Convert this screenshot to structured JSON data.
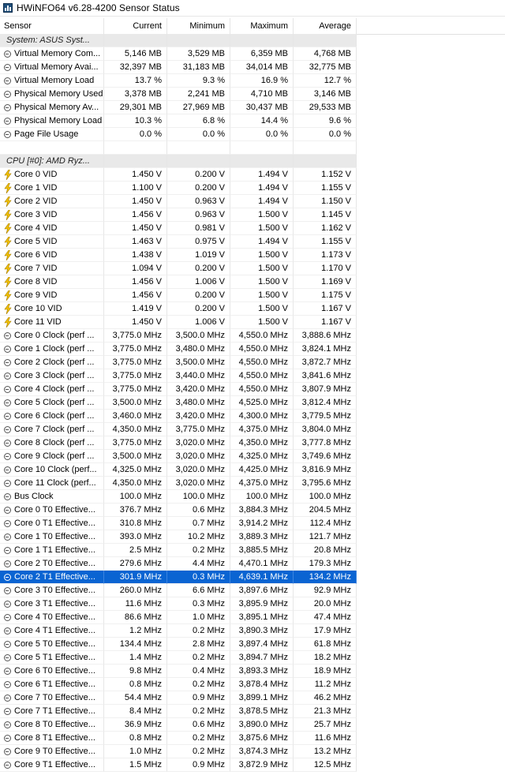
{
  "window": {
    "title": "HWiNFO64 v6.28-4200 Sensor Status"
  },
  "columns": [
    "Sensor",
    "Current",
    "Minimum",
    "Maximum",
    "Average"
  ],
  "rows": [
    {
      "type": "group",
      "label": "System: ASUS Syst..."
    },
    {
      "type": "sensor",
      "icon": "clock",
      "label": "Virtual Memory Com...",
      "cur": "5,146 MB",
      "min": "3,529 MB",
      "max": "6,359 MB",
      "avg": "4,768 MB"
    },
    {
      "type": "sensor",
      "icon": "clock",
      "label": "Virtual Memory Avai...",
      "cur": "32,397 MB",
      "min": "31,183 MB",
      "max": "34,014 MB",
      "avg": "32,775 MB"
    },
    {
      "type": "sensor",
      "icon": "clock",
      "label": "Virtual Memory Load",
      "cur": "13.7 %",
      "min": "9.3 %",
      "max": "16.9 %",
      "avg": "12.7 %"
    },
    {
      "type": "sensor",
      "icon": "clock",
      "label": "Physical Memory Used",
      "cur": "3,378 MB",
      "min": "2,241 MB",
      "max": "4,710 MB",
      "avg": "3,146 MB"
    },
    {
      "type": "sensor",
      "icon": "clock",
      "label": "Physical Memory Av...",
      "cur": "29,301 MB",
      "min": "27,969 MB",
      "max": "30,437 MB",
      "avg": "29,533 MB"
    },
    {
      "type": "sensor",
      "icon": "clock",
      "label": "Physical Memory Load",
      "cur": "10.3 %",
      "min": "6.8 %",
      "max": "14.4 %",
      "avg": "9.6 %"
    },
    {
      "type": "sensor",
      "icon": "clock",
      "label": "Page File Usage",
      "cur": "0.0 %",
      "min": "0.0 %",
      "max": "0.0 %",
      "avg": "0.0 %"
    },
    {
      "type": "empty"
    },
    {
      "type": "group",
      "label": "CPU [#0]: AMD Ryz..."
    },
    {
      "type": "sensor",
      "icon": "bolt",
      "label": "Core 0 VID",
      "cur": "1.450 V",
      "min": "0.200 V",
      "max": "1.494 V",
      "avg": "1.152 V"
    },
    {
      "type": "sensor",
      "icon": "bolt",
      "label": "Core 1 VID",
      "cur": "1.100 V",
      "min": "0.200 V",
      "max": "1.494 V",
      "avg": "1.155 V"
    },
    {
      "type": "sensor",
      "icon": "bolt",
      "label": "Core 2 VID",
      "cur": "1.450 V",
      "min": "0.963 V",
      "max": "1.494 V",
      "avg": "1.150 V"
    },
    {
      "type": "sensor",
      "icon": "bolt",
      "label": "Core 3 VID",
      "cur": "1.456 V",
      "min": "0.963 V",
      "max": "1.500 V",
      "avg": "1.145 V"
    },
    {
      "type": "sensor",
      "icon": "bolt",
      "label": "Core 4 VID",
      "cur": "1.450 V",
      "min": "0.981 V",
      "max": "1.500 V",
      "avg": "1.162 V"
    },
    {
      "type": "sensor",
      "icon": "bolt",
      "label": "Core 5 VID",
      "cur": "1.463 V",
      "min": "0.975 V",
      "max": "1.494 V",
      "avg": "1.155 V"
    },
    {
      "type": "sensor",
      "icon": "bolt",
      "label": "Core 6 VID",
      "cur": "1.438 V",
      "min": "1.019 V",
      "max": "1.500 V",
      "avg": "1.173 V"
    },
    {
      "type": "sensor",
      "icon": "bolt",
      "label": "Core 7 VID",
      "cur": "1.094 V",
      "min": "0.200 V",
      "max": "1.500 V",
      "avg": "1.170 V"
    },
    {
      "type": "sensor",
      "icon": "bolt",
      "label": "Core 8 VID",
      "cur": "1.456 V",
      "min": "1.006 V",
      "max": "1.500 V",
      "avg": "1.169 V"
    },
    {
      "type": "sensor",
      "icon": "bolt",
      "label": "Core 9 VID",
      "cur": "1.456 V",
      "min": "0.200 V",
      "max": "1.500 V",
      "avg": "1.175 V"
    },
    {
      "type": "sensor",
      "icon": "bolt",
      "label": "Core 10 VID",
      "cur": "1.419 V",
      "min": "0.200 V",
      "max": "1.500 V",
      "avg": "1.167 V"
    },
    {
      "type": "sensor",
      "icon": "bolt",
      "label": "Core 11 VID",
      "cur": "1.450 V",
      "min": "1.006 V",
      "max": "1.500 V",
      "avg": "1.167 V"
    },
    {
      "type": "sensor",
      "icon": "clock",
      "label": "Core 0 Clock (perf ...",
      "cur": "3,775.0 MHz",
      "min": "3,500.0 MHz",
      "max": "4,550.0 MHz",
      "avg": "3,888.6 MHz"
    },
    {
      "type": "sensor",
      "icon": "clock",
      "label": "Core 1 Clock (perf ...",
      "cur": "3,775.0 MHz",
      "min": "3,480.0 MHz",
      "max": "4,550.0 MHz",
      "avg": "3,824.1 MHz"
    },
    {
      "type": "sensor",
      "icon": "clock",
      "label": "Core 2 Clock (perf ...",
      "cur": "3,775.0 MHz",
      "min": "3,500.0 MHz",
      "max": "4,550.0 MHz",
      "avg": "3,872.7 MHz"
    },
    {
      "type": "sensor",
      "icon": "clock",
      "label": "Core 3 Clock (perf ...",
      "cur": "3,775.0 MHz",
      "min": "3,440.0 MHz",
      "max": "4,550.0 MHz",
      "avg": "3,841.6 MHz"
    },
    {
      "type": "sensor",
      "icon": "clock",
      "label": "Core 4 Clock (perf ...",
      "cur": "3,775.0 MHz",
      "min": "3,420.0 MHz",
      "max": "4,550.0 MHz",
      "avg": "3,807.9 MHz"
    },
    {
      "type": "sensor",
      "icon": "clock",
      "label": "Core 5 Clock (perf ...",
      "cur": "3,500.0 MHz",
      "min": "3,480.0 MHz",
      "max": "4,525.0 MHz",
      "avg": "3,812.4 MHz"
    },
    {
      "type": "sensor",
      "icon": "clock",
      "label": "Core 6 Clock (perf ...",
      "cur": "3,460.0 MHz",
      "min": "3,420.0 MHz",
      "max": "4,300.0 MHz",
      "avg": "3,779.5 MHz"
    },
    {
      "type": "sensor",
      "icon": "clock",
      "label": "Core 7 Clock (perf ...",
      "cur": "4,350.0 MHz",
      "min": "3,775.0 MHz",
      "max": "4,375.0 MHz",
      "avg": "3,804.0 MHz"
    },
    {
      "type": "sensor",
      "icon": "clock",
      "label": "Core 8 Clock (perf ...",
      "cur": "3,775.0 MHz",
      "min": "3,020.0 MHz",
      "max": "4,350.0 MHz",
      "avg": "3,777.8 MHz"
    },
    {
      "type": "sensor",
      "icon": "clock",
      "label": "Core 9 Clock (perf ...",
      "cur": "3,500.0 MHz",
      "min": "3,020.0 MHz",
      "max": "4,325.0 MHz",
      "avg": "3,749.6 MHz"
    },
    {
      "type": "sensor",
      "icon": "clock",
      "label": "Core 10 Clock (perf...",
      "cur": "4,325.0 MHz",
      "min": "3,020.0 MHz",
      "max": "4,425.0 MHz",
      "avg": "3,816.9 MHz"
    },
    {
      "type": "sensor",
      "icon": "clock",
      "label": "Core 11 Clock (perf...",
      "cur": "4,350.0 MHz",
      "min": "3,020.0 MHz",
      "max": "4,375.0 MHz",
      "avg": "3,795.6 MHz"
    },
    {
      "type": "sensor",
      "icon": "clock",
      "label": "Bus Clock",
      "cur": "100.0 MHz",
      "min": "100.0 MHz",
      "max": "100.0 MHz",
      "avg": "100.0 MHz"
    },
    {
      "type": "sensor",
      "icon": "clock",
      "label": "Core 0 T0 Effective...",
      "cur": "376.7 MHz",
      "min": "0.6 MHz",
      "max": "3,884.3 MHz",
      "avg": "204.5 MHz"
    },
    {
      "type": "sensor",
      "icon": "clock",
      "label": "Core 0 T1 Effective...",
      "cur": "310.8 MHz",
      "min": "0.7 MHz",
      "max": "3,914.2 MHz",
      "avg": "112.4 MHz"
    },
    {
      "type": "sensor",
      "icon": "clock",
      "label": "Core 1 T0 Effective...",
      "cur": "393.0 MHz",
      "min": "10.2 MHz",
      "max": "3,889.3 MHz",
      "avg": "121.7 MHz"
    },
    {
      "type": "sensor",
      "icon": "clock",
      "label": "Core 1 T1 Effective...",
      "cur": "2.5 MHz",
      "min": "0.2 MHz",
      "max": "3,885.5 MHz",
      "avg": "20.8 MHz"
    },
    {
      "type": "sensor",
      "icon": "clock",
      "label": "Core 2 T0 Effective...",
      "cur": "279.6 MHz",
      "min": "4.4 MHz",
      "max": "4,470.1 MHz",
      "avg": "179.3 MHz"
    },
    {
      "type": "sensor",
      "icon": "clock",
      "label": "Core 2 T1 Effective...",
      "cur": "301.9 MHz",
      "min": "0.3 MHz",
      "max": "4,639.1 MHz",
      "avg": "134.2 MHz",
      "selected": true
    },
    {
      "type": "sensor",
      "icon": "clock",
      "label": "Core 3 T0 Effective...",
      "cur": "260.0 MHz",
      "min": "6.6 MHz",
      "max": "3,897.6 MHz",
      "avg": "92.9 MHz"
    },
    {
      "type": "sensor",
      "icon": "clock",
      "label": "Core 3 T1 Effective...",
      "cur": "11.6 MHz",
      "min": "0.3 MHz",
      "max": "3,895.9 MHz",
      "avg": "20.0 MHz"
    },
    {
      "type": "sensor",
      "icon": "clock",
      "label": "Core 4 T0 Effective...",
      "cur": "86.6 MHz",
      "min": "1.0 MHz",
      "max": "3,895.1 MHz",
      "avg": "47.4 MHz"
    },
    {
      "type": "sensor",
      "icon": "clock",
      "label": "Core 4 T1 Effective...",
      "cur": "1.2 MHz",
      "min": "0.2 MHz",
      "max": "3,890.3 MHz",
      "avg": "17.9 MHz"
    },
    {
      "type": "sensor",
      "icon": "clock",
      "label": "Core 5 T0 Effective...",
      "cur": "134.4 MHz",
      "min": "2.8 MHz",
      "max": "3,897.4 MHz",
      "avg": "61.8 MHz"
    },
    {
      "type": "sensor",
      "icon": "clock",
      "label": "Core 5 T1 Effective...",
      "cur": "1.4 MHz",
      "min": "0.2 MHz",
      "max": "3,894.7 MHz",
      "avg": "18.2 MHz"
    },
    {
      "type": "sensor",
      "icon": "clock",
      "label": "Core 6 T0 Effective...",
      "cur": "9.8 MHz",
      "min": "0.4 MHz",
      "max": "3,893.3 MHz",
      "avg": "18.9 MHz"
    },
    {
      "type": "sensor",
      "icon": "clock",
      "label": "Core 6 T1 Effective...",
      "cur": "0.8 MHz",
      "min": "0.2 MHz",
      "max": "3,878.4 MHz",
      "avg": "11.2 MHz"
    },
    {
      "type": "sensor",
      "icon": "clock",
      "label": "Core 7 T0 Effective...",
      "cur": "54.4 MHz",
      "min": "0.9 MHz",
      "max": "3,899.1 MHz",
      "avg": "46.2 MHz"
    },
    {
      "type": "sensor",
      "icon": "clock",
      "label": "Core 7 T1 Effective...",
      "cur": "8.4 MHz",
      "min": "0.2 MHz",
      "max": "3,878.5 MHz",
      "avg": "21.3 MHz"
    },
    {
      "type": "sensor",
      "icon": "clock",
      "label": "Core 8 T0 Effective...",
      "cur": "36.9 MHz",
      "min": "0.6 MHz",
      "max": "3,890.0 MHz",
      "avg": "25.7 MHz"
    },
    {
      "type": "sensor",
      "icon": "clock",
      "label": "Core 8 T1 Effective...",
      "cur": "0.8 MHz",
      "min": "0.2 MHz",
      "max": "3,875.6 MHz",
      "avg": "11.6 MHz"
    },
    {
      "type": "sensor",
      "icon": "clock",
      "label": "Core 9 T0 Effective...",
      "cur": "1.0 MHz",
      "min": "0.2 MHz",
      "max": "3,874.3 MHz",
      "avg": "13.2 MHz"
    },
    {
      "type": "sensor",
      "icon": "clock",
      "label": "Core 9 T1 Effective...",
      "cur": "1.5 MHz",
      "min": "0.9 MHz",
      "max": "3,872.9 MHz",
      "avg": "12.5 MHz"
    }
  ]
}
